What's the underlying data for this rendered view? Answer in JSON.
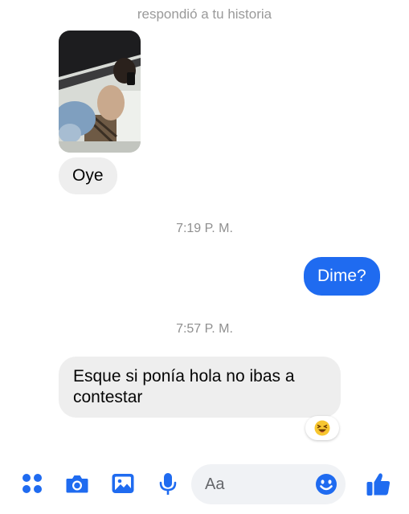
{
  "story_reply": {
    "label": "respondió a tu historia"
  },
  "messages": [
    {
      "text": "Oye",
      "side": "incoming"
    },
    {
      "timestamp": "7:19 P. M."
    },
    {
      "text": "Dime?",
      "side": "outgoing"
    },
    {
      "timestamp": "7:57 P. M."
    },
    {
      "text": "Esque si ponía hola no ibas a contestar",
      "side": "incoming",
      "reaction_icon": "laughing-emoji-icon"
    }
  ],
  "composer": {
    "placeholder": "Aa",
    "icons": [
      "apps-icon",
      "camera-icon",
      "gallery-icon",
      "microphone-icon",
      "emoji-icon",
      "thumbs-up-icon"
    ]
  },
  "colors": {
    "accent": "#1f6bf0",
    "incoming_bubble": "#eeeeee",
    "meta_text": "#8f8f8f"
  }
}
